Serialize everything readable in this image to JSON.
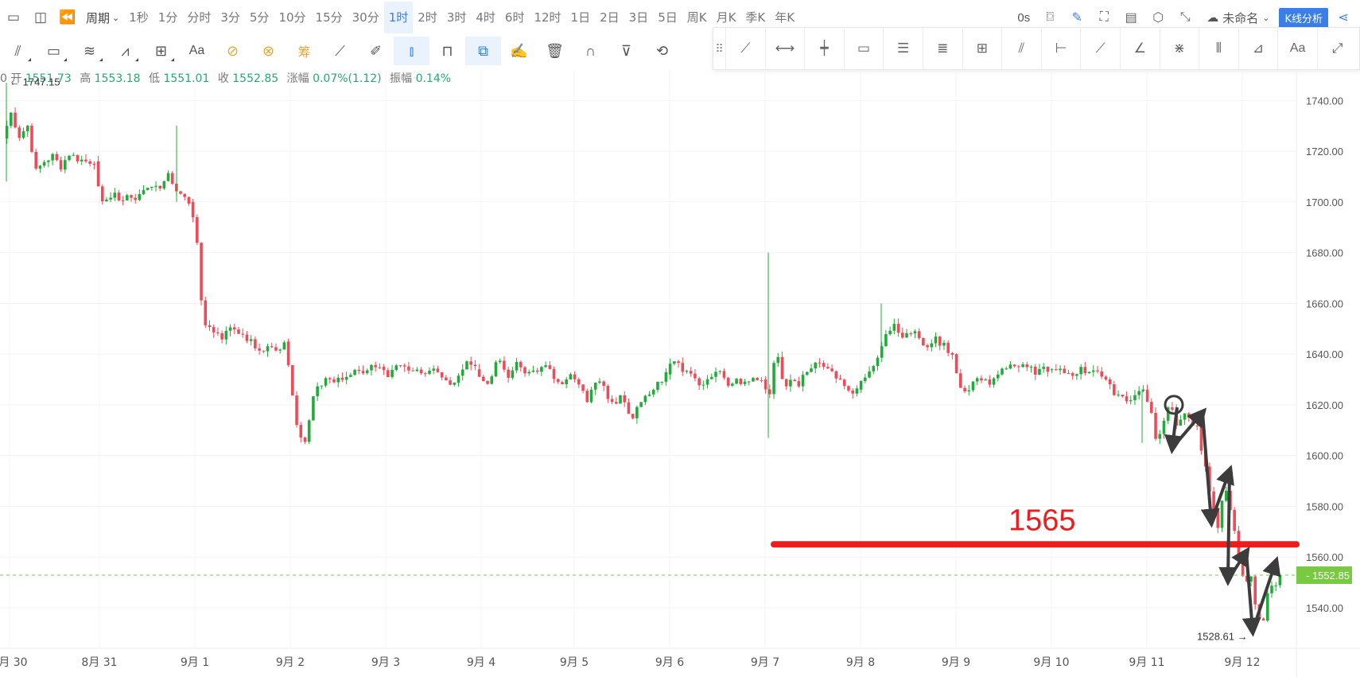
{
  "toolbar": {
    "period_dropdown": "周期",
    "periods": [
      "1秒",
      "1分",
      "分时",
      "3分",
      "5分",
      "10分",
      "15分",
      "30分",
      "1时",
      "2时",
      "3时",
      "4时",
      "6时",
      "12时",
      "1日",
      "2日",
      "3日",
      "5日",
      "周K",
      "月K",
      "季K",
      "年K"
    ],
    "active_period": "1时",
    "countdown": "0s",
    "layout_name": "未命名",
    "analysis_button": "K线分析",
    "gold_tool_label": "筹",
    "text_tool_label": "Aa"
  },
  "ohlc": {
    "prefix": "0",
    "open_label": "开",
    "open": "1551.73",
    "high_label": "高",
    "high": "1553.18",
    "low_label": "低",
    "low": "1551.01",
    "close_label": "收",
    "close": "1552.85",
    "change_label": "涨幅",
    "change": "0.07%(1.12)",
    "amplitude_label": "振幅",
    "amplitude": "0.14%"
  },
  "chart_data": {
    "type": "candlestick",
    "y_ticks": [
      "1740.00",
      "1720.00",
      "1700.00",
      "1680.00",
      "1660.00",
      "1640.00",
      "1620.00",
      "1600.00",
      "1580.00",
      "1560.00",
      "1540.00"
    ],
    "x_ticks": [
      "8月 30",
      "8月 31",
      "9月 1",
      "9月 2",
      "9月 3",
      "9月 4",
      "9月 5",
      "9月 6",
      "9月 7",
      "9月 8",
      "9月 9",
      "9月 10",
      "9月 11",
      "9月 12"
    ],
    "ylim": [
      1524,
      1752
    ],
    "last_price": "1552.85",
    "high_marker": "1747.15",
    "low_marker": "1528.61",
    "key_level": 1565,
    "key_level_label": "1565",
    "colors": {
      "up": "#22ab3a",
      "down": "#ef4a57",
      "level": "#ee1c1c",
      "last_price": "#7ac943",
      "arrows": "#3c3c3c"
    },
    "series": [
      {
        "date": "8月 30",
        "path": [
          1725,
          1735,
          1726,
          1730,
          1712,
          1716,
          1718,
          1714,
          1719,
          1717,
          1716,
          1716
        ]
      },
      {
        "date": "8月 31",
        "path": [
          1716,
          1700,
          1702,
          1703,
          1701,
          1702,
          1699,
          1703,
          1705,
          1706,
          1707,
          1712,
          1705,
          1702,
          1700
        ]
      },
      {
        "date": "9月 1",
        "path": [
          1700,
          1692,
          1655,
          1650,
          1648,
          1646,
          1650,
          1649,
          1648,
          1645,
          1643,
          1642,
          1645,
          1640,
          1645
        ]
      },
      {
        "date": "9月 2",
        "path": [
          1645,
          1626,
          1608,
          1606,
          1625,
          1628,
          1630,
          1629,
          1631,
          1632,
          1633,
          1634,
          1636,
          1635
        ]
      },
      {
        "date": "9月 3",
        "path": [
          1635,
          1632,
          1634,
          1636,
          1633,
          1634,
          1632,
          1634,
          1630,
          1628,
          1633,
          1636,
          1634
        ]
      },
      {
        "date": "9月 4",
        "path": [
          1634,
          1628,
          1631,
          1640,
          1630,
          1636,
          1634,
          1632,
          1635,
          1637,
          1631,
          1628,
          1632
        ]
      },
      {
        "date": "9月 5",
        "path": [
          1632,
          1628,
          1622,
          1630,
          1626,
          1618,
          1624,
          1614,
          1620,
          1624,
          1628,
          1632
        ]
      },
      {
        "date": "9月 6",
        "path": [
          1632,
          1638,
          1632,
          1634,
          1627,
          1630,
          1633,
          1628,
          1630,
          1628,
          1631,
          1630
        ]
      },
      {
        "date": "9月 7",
        "path": [
          1630,
          1623,
          1642,
          1626,
          1630,
          1628,
          1632,
          1636,
          1638,
          1634,
          1632,
          1628,
          1624,
          1626
        ]
      },
      {
        "date": "9月 8",
        "path": [
          1626,
          1632,
          1638,
          1648,
          1652,
          1646,
          1650,
          1642,
          1646,
          1644,
          1640
        ]
      },
      {
        "date": "9月 9",
        "path": [
          1640,
          1624,
          1628,
          1630,
          1628,
          1634,
          1636,
          1635,
          1634,
          1633,
          1634
        ]
      },
      {
        "date": "9月 10",
        "path": [
          1634,
          1633,
          1633,
          1632,
          1634,
          1633,
          1635,
          1630,
          1626,
          1624,
          1622,
          1624,
          1626
        ]
      },
      {
        "date": "9月 11",
        "path": [
          1626,
          1618,
          1606,
          1612,
          1622,
          1612,
          1616,
          1614,
          1610,
          1596,
          1584,
          1572,
          1590,
          1576,
          1560
        ]
      },
      {
        "date": "9月 12",
        "path": [
          1560,
          1550,
          1554,
          1540,
          1531,
          1546,
          1549,
          1552.85
        ]
      }
    ],
    "pattern_arrows": [
      [
        1619,
        1603
      ],
      [
        1603,
        1617
      ],
      [
        1617,
        1574
      ],
      [
        1574,
        1594
      ],
      [
        1594,
        1551
      ],
      [
        1551,
        1562
      ],
      [
        1562,
        1531
      ],
      [
        1531,
        1558
      ]
    ]
  }
}
